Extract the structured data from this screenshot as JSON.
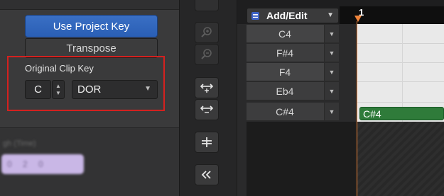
{
  "clip_inspector": {
    "use_project_key_label": "Use Project Key",
    "transpose_label": "Transpose",
    "original_clip_key_label": "Original Clip Key",
    "key_note_value": "C",
    "mode_value": "DOR",
    "blurred_label": "gh (Time)",
    "blurred_value": "0 2 0"
  },
  "tools": {
    "buttons": [
      {
        "icon": "zoom-in-icon"
      },
      {
        "icon": "zoom-out-icon"
      },
      {
        "icon": "expand-vertical-icon"
      },
      {
        "icon": "collapse-vertical-icon"
      },
      {
        "icon": "fit-icon"
      },
      {
        "icon": "double-chevron-left-icon"
      }
    ]
  },
  "piano_roll": {
    "menu_label": "Add/Edit",
    "bar_number": "1",
    "pitch_rows": [
      {
        "label": "C4"
      },
      {
        "label": "F#4"
      },
      {
        "label": "F4"
      },
      {
        "label": "Eb4"
      },
      {
        "label": "C#4"
      }
    ],
    "note_label": "C#4"
  },
  "colors": {
    "accent_blue": "#2a5fb5",
    "highlight_red": "#d4211f",
    "playhead_orange": "#f0843a",
    "note_green": "#2f7b3a"
  }
}
